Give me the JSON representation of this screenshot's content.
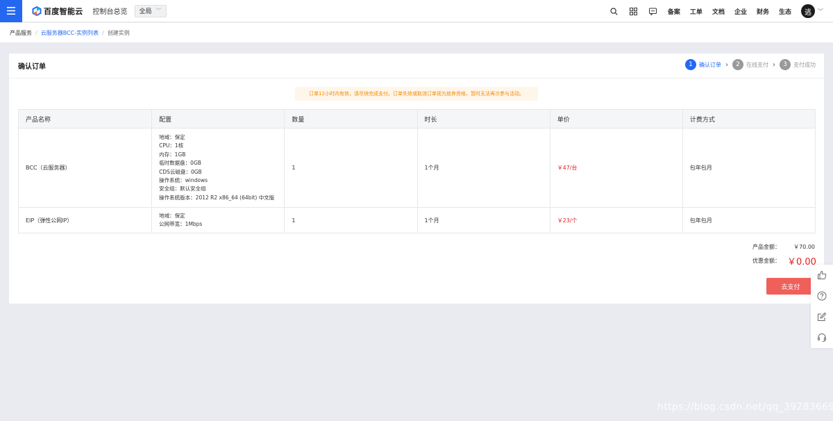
{
  "nav": {
    "menu_icon": "hamburger-icon",
    "logo_text": "百度智能云",
    "console_link": "控制台总览",
    "region": "全局",
    "icons": [
      "search-icon",
      "grid-icon",
      "message-icon"
    ],
    "links": [
      "备案",
      "工单",
      "文档",
      "企业",
      "财务",
      "生态"
    ],
    "avatar": "逃"
  },
  "breadcrumb": {
    "root": "产品服务",
    "link": "云服务器BCC-实例列表",
    "current": "创建实例"
  },
  "card": {
    "title": "确认订单",
    "steps": [
      {
        "num": "1",
        "label": "确认订单"
      },
      {
        "num": "2",
        "label": "在线支付"
      },
      {
        "num": "3",
        "label": "支付成功"
      }
    ],
    "notice": "订单12小时内有效，请尽快完成支付。订单失效或取消订单视为放弃资格，暂时无法再次参与活动。"
  },
  "table": {
    "headers": [
      "产品名称",
      "配置",
      "数量",
      "时长",
      "单价",
      "计费方式"
    ],
    "rows": [
      {
        "name": "BCC（云服务器）",
        "config": [
          "地域：保定",
          "CPU：1核",
          "内存：1GB",
          "临时数据盘：0GB",
          "CDS云磁盘：0GB",
          "操作系统：windows",
          "安全组：默认安全组",
          "操作系统版本：2012 R2 x86_64 (64bit) 中文版"
        ],
        "qty": "1",
        "duration": "1个月",
        "price": "￥47/台",
        "billing": "包年包月"
      },
      {
        "name": "EIP（弹性公网IP）",
        "config": [
          "地域：保定",
          "公网带宽：1Mbps"
        ],
        "qty": "1",
        "duration": "1个月",
        "price": "￥23/个",
        "billing": "包年包月"
      }
    ]
  },
  "totals": {
    "product_label": "产品金额：",
    "product_value": "￥70.00",
    "discount_label": "优惠金额：",
    "discount_value": "￥0.00"
  },
  "pay_button": "去支付",
  "float_icons": [
    "thumbs-up-icon",
    "help-icon",
    "edit-icon",
    "headset-icon"
  ],
  "watermark": "https://blog.csdn.net/qq_39283669",
  "colors": {
    "accent": "#2468f2",
    "price": "#e02020",
    "pay": "#f0605b",
    "notice": "#f38900"
  }
}
